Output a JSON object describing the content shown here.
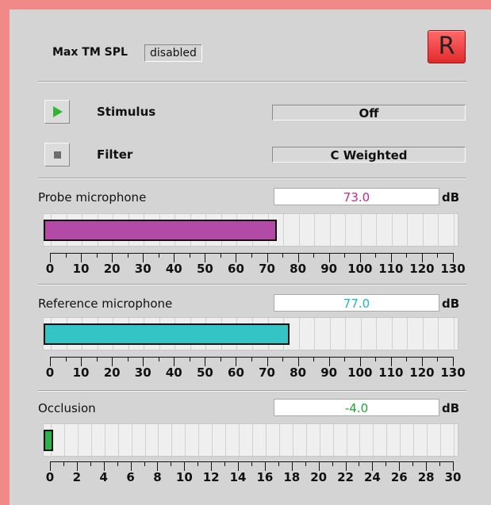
{
  "header": {
    "max_tm_spl_label": "Max TM SPL",
    "max_tm_spl_value": "disabled",
    "r_button_label": "R"
  },
  "controls": {
    "stimulus": {
      "label": "Stimulus",
      "value": "Off",
      "icon": "play-icon"
    },
    "filter": {
      "label": "Filter",
      "value": "C Weighted",
      "icon": "stop-icon"
    }
  },
  "meters": {
    "probe": {
      "label": "Probe microphone",
      "value": "73.0",
      "level": 73.0,
      "unit": "dB",
      "color": "#b34aa6",
      "text_color": "#c0289a",
      "scale_max": 130,
      "ticks": [
        "0",
        "10",
        "20",
        "30",
        "40",
        "50",
        "60",
        "70",
        "80",
        "90",
        "100",
        "110",
        "120",
        "130"
      ]
    },
    "reference": {
      "label": "Reference microphone",
      "value": "77.0",
      "level": 77.0,
      "unit": "dB",
      "color": "#34c4c6",
      "text_color": "#1fb6c8",
      "scale_max": 130,
      "ticks": [
        "0",
        "10",
        "20",
        "30",
        "40",
        "50",
        "60",
        "70",
        "80",
        "90",
        "100",
        "110",
        "120",
        "130"
      ]
    },
    "occlusion": {
      "label": "Occlusion",
      "value": "-4.0",
      "level": 0.2,
      "unit": "dB",
      "color": "#2bb34a",
      "text_color": "#1ea82a",
      "scale_max": 30,
      "ticks": [
        "0",
        "2",
        "4",
        "6",
        "8",
        "10",
        "12",
        "14",
        "16",
        "18",
        "20",
        "22",
        "24",
        "26",
        "28",
        "30"
      ]
    }
  }
}
